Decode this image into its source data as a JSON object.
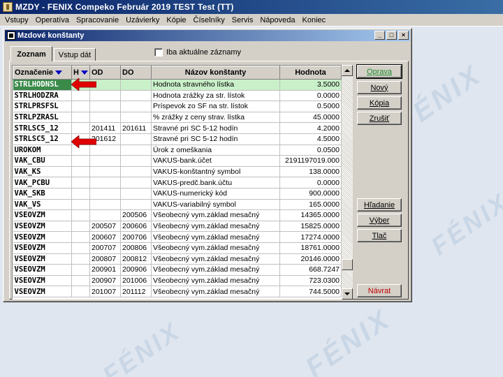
{
  "app": {
    "title": "MZDY - FENIX Compeko  Február 2019   TEST Test  (TT)"
  },
  "menu": [
    "Vstupy",
    "Operatíva",
    "Spracovanie",
    "Uzávierky",
    "Kópie",
    "Číselníky",
    "Servis",
    "Nápoveda",
    "Koniec"
  ],
  "background": {
    "watermark": "FÉNIX"
  },
  "window": {
    "title": "Mzdové konštanty",
    "controls": {
      "minimize": "_",
      "maximize": "□",
      "close": "×"
    }
  },
  "tabs": {
    "active": "Zoznam",
    "inactive": "Vstup dát"
  },
  "filter": {
    "only_current_label": "Iba aktuálne záznamy",
    "checked": false
  },
  "grid": {
    "columns": {
      "code": "Označenie",
      "h": "H",
      "od": "OD",
      "do": "DO",
      "name": "Názov konštanty",
      "value": "Hodnota"
    },
    "rows": [
      {
        "code": "STRLHODNSL",
        "h": "",
        "od": "",
        "do": "",
        "name": "Hodnota stravného lístka",
        "value": "3.5000",
        "selected": true
      },
      {
        "code": "STRLHODZRA",
        "h": "",
        "od": "",
        "do": "",
        "name": "Hodnota zrážky za str. lístok",
        "value": "0.0000"
      },
      {
        "code": "STRLPRSFSL",
        "h": "",
        "od": "",
        "do": "",
        "name": "Príspevok zo SF na str. lístok",
        "value": "0.5000"
      },
      {
        "code": "STRLPZRASL",
        "h": "",
        "od": "",
        "do": "",
        "name": "% zrážky z ceny strav. lístka",
        "value": "45.0000"
      },
      {
        "code": "STRLSC5_12",
        "h": "",
        "od": "201411",
        "do": "201611",
        "name": "Stravné pri SC 5-12 hodín",
        "value": "4.2000"
      },
      {
        "code": "STRLSC5_12",
        "h": "",
        "od": "201612",
        "do": "",
        "name": "Stravné pri SC 5-12 hodín",
        "value": "4.5000"
      },
      {
        "code": "UROKOM",
        "h": "",
        "od": "",
        "do": "",
        "name": "Úrok z omeškania",
        "value": "0.0500"
      },
      {
        "code": "VAK_CBU",
        "h": "",
        "od": "",
        "do": "",
        "name": "VAKUS-bank.účet",
        "value": "2191197019.000"
      },
      {
        "code": "VAK_KS",
        "h": "",
        "od": "",
        "do": "",
        "name": "VAKUS-konštantný symbol",
        "value": "138.0000"
      },
      {
        "code": "VAK_PCBU",
        "h": "",
        "od": "",
        "do": "",
        "name": "VAKUS-predč.bank.účtu",
        "value": "0.0000"
      },
      {
        "code": "VAK_SKB",
        "h": "",
        "od": "",
        "do": "",
        "name": "VAKUS-numerický kód",
        "value": "900.0000"
      },
      {
        "code": "VAK_VS",
        "h": "",
        "od": "",
        "do": "",
        "name": "VAKUS-variabilný symbol",
        "value": "165.0000"
      },
      {
        "code": "VSEOVZM",
        "h": "",
        "od": "",
        "do": "200506",
        "name": "Všeobecný vym.základ mesačný",
        "value": "14365.0000"
      },
      {
        "code": "VSEOVZM",
        "h": "",
        "od": "200507",
        "do": "200606",
        "name": "Všeobecný vym.základ mesačný",
        "value": "15825.0000"
      },
      {
        "code": "VSEOVZM",
        "h": "",
        "od": "200607",
        "do": "200706",
        "name": "Všeobecný vym.základ mesačný",
        "value": "17274.0000"
      },
      {
        "code": "VSEOVZM",
        "h": "",
        "od": "200707",
        "do": "200806",
        "name": "Všeobecný vym.základ mesačný",
        "value": "18761.0000"
      },
      {
        "code": "VSEOVZM",
        "h": "",
        "od": "200807",
        "do": "200812",
        "name": "Všeobecný vym.základ mesačný",
        "value": "20146.0000"
      },
      {
        "code": "VSEOVZM",
        "h": "",
        "od": "200901",
        "do": "200906",
        "name": "Všeobecný vym.základ mesačný",
        "value": "668.7247"
      },
      {
        "code": "VSEOVZM",
        "h": "",
        "od": "200907",
        "do": "201006",
        "name": "Všeobecný vym.základ mesačný",
        "value": "723.0300"
      },
      {
        "code": "VSEOVZM",
        "h": "",
        "od": "201007",
        "do": "201112",
        "name": "Všeobecný vym.základ mesačný",
        "value": "744.5000"
      }
    ]
  },
  "buttons": {
    "edit": "Oprava",
    "new": "Nový",
    "copy": "Kópia",
    "cancel": "Zrušiť",
    "search": "Hľadanie",
    "select": "Výber",
    "print": "Tlač",
    "back": "Návrat"
  },
  "colors": {
    "selected_row": "#c9f0c9",
    "selected_code": "#3a8a4a",
    "annotation_arrow": "#e00000",
    "back_button": "#c00000"
  }
}
